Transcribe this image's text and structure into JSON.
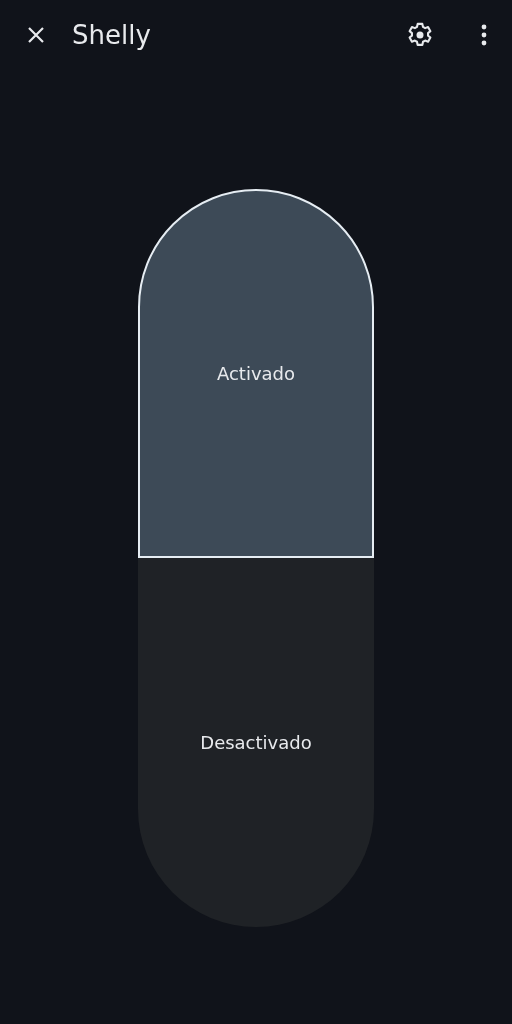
{
  "app_bar": {
    "title": "Shelly"
  },
  "switch": {
    "options": [
      {
        "label": "Activado",
        "selected": true
      },
      {
        "label": "Desactivado",
        "selected": false
      }
    ]
  }
}
